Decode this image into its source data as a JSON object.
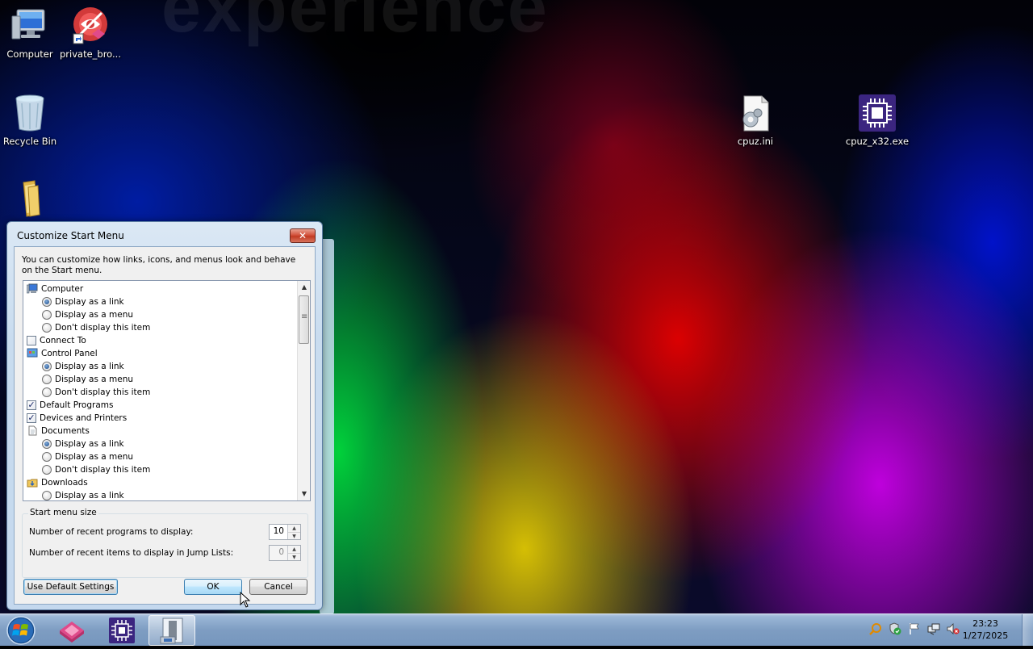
{
  "desktop": {
    "watermark": "experience",
    "icons": [
      {
        "label": "Computer"
      },
      {
        "label": "private_bro..."
      },
      {
        "label": "Recycle Bin"
      },
      {
        "label": ""
      },
      {
        "label": "cpuz.ini"
      },
      {
        "label": "cpuz_x32.exe"
      }
    ]
  },
  "dialog": {
    "title": "Customize Start Menu",
    "close_label": "✕",
    "description": "You can customize how links, icons, and menus look and behave on the Start menu.",
    "tree_items": [
      {
        "kind": "header",
        "icon": "computer-icon",
        "label": "Computer"
      },
      {
        "kind": "radio",
        "checked": true,
        "label": "Display as a link"
      },
      {
        "kind": "radio",
        "checked": false,
        "label": "Display as a menu"
      },
      {
        "kind": "radio",
        "checked": false,
        "label": "Don't display this item"
      },
      {
        "kind": "checkbox",
        "checked": false,
        "label": "Connect To"
      },
      {
        "kind": "header",
        "icon": "control-panel-icon",
        "label": "Control Panel"
      },
      {
        "kind": "radio",
        "checked": true,
        "label": "Display as a link"
      },
      {
        "kind": "radio",
        "checked": false,
        "label": "Display as a menu"
      },
      {
        "kind": "radio",
        "checked": false,
        "label": "Don't display this item"
      },
      {
        "kind": "checkbox",
        "checked": true,
        "label": "Default Programs"
      },
      {
        "kind": "checkbox",
        "checked": true,
        "label": "Devices and Printers"
      },
      {
        "kind": "header",
        "icon": "documents-icon",
        "label": "Documents"
      },
      {
        "kind": "radio",
        "checked": true,
        "label": "Display as a link"
      },
      {
        "kind": "radio",
        "checked": false,
        "label": "Display as a menu"
      },
      {
        "kind": "radio",
        "checked": false,
        "label": "Don't display this item"
      },
      {
        "kind": "header",
        "icon": "downloads-icon",
        "label": "Downloads"
      },
      {
        "kind": "radio",
        "checked": false,
        "label": "Display as a link"
      }
    ],
    "start_menu_size": {
      "group_label": "Start menu size",
      "recent_programs_label": "Number of recent programs to display:",
      "recent_programs_value": "10",
      "jump_list_label": "Number of recent items to display in Jump Lists:",
      "jump_list_value": "0"
    },
    "buttons": {
      "defaults": "Use Default Settings",
      "ok": "OK",
      "cancel": "Cancel"
    }
  },
  "taskbar": {
    "clock_time": "23:23",
    "clock_date": "1/27/2025"
  },
  "colors": {
    "taskbar": "#7e9dc2",
    "dialog_frame": "#c9dcef",
    "close_button": "#c13a22"
  }
}
